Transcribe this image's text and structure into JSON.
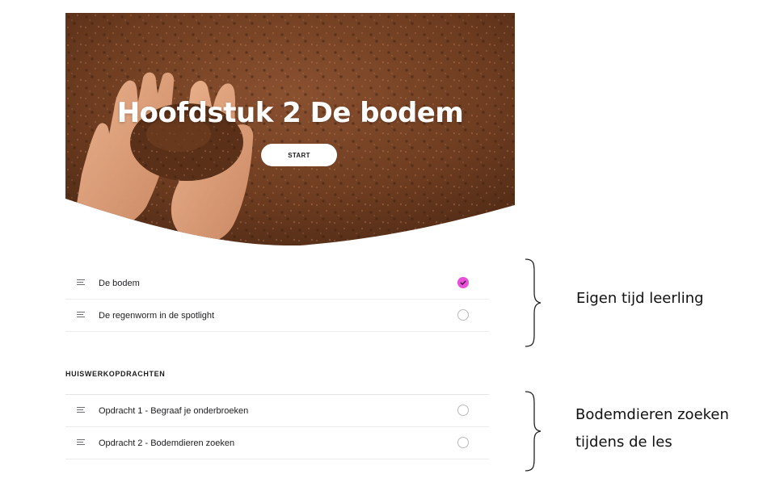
{
  "hero": {
    "title": "Hoofdstuk 2 De bodem",
    "start_label": "START",
    "image_subject": "hands holding soil"
  },
  "lessons": [
    {
      "label": "De bodem",
      "status": "completed"
    },
    {
      "label": "De regenworm in de spotlight",
      "status": "not-started"
    }
  ],
  "homework": {
    "heading": "HUISWERKOPDRACHTEN",
    "items": [
      {
        "label": "Opdracht 1 - Begraaf je onderbroeken",
        "status": "not-started"
      },
      {
        "label": "Opdracht 2 - Bodemdieren zoeken",
        "status": "not-started"
      }
    ]
  },
  "annotations": {
    "first_group": "Eigen tijd leerling",
    "second_group_line1": "Bodemdieren zoeken",
    "second_group_line2": "tijdens de les"
  },
  "colors": {
    "completed": "#ea4fd9",
    "soil": "#7a4424",
    "text": "#1d1d1f"
  },
  "icons": {
    "row": "lines-icon",
    "done": "check-icon",
    "open": "circle-outline-icon"
  }
}
